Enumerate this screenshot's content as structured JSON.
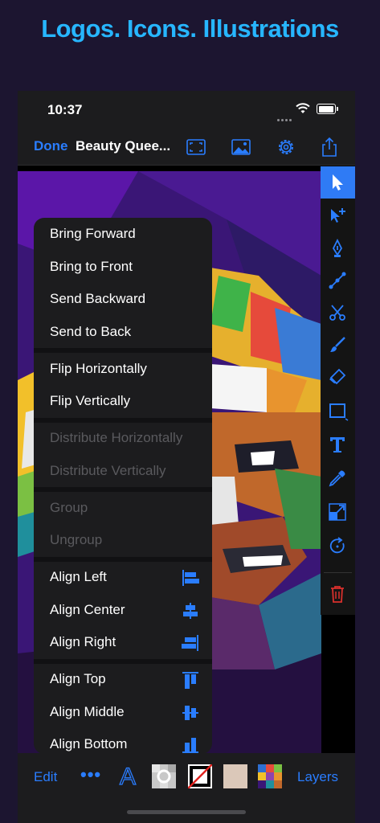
{
  "headline": "Logos. Icons. Illustrations",
  "status_bar": {
    "time": "10:37"
  },
  "nav_bar": {
    "done_label": "Done",
    "title": "Beauty Quee...",
    "icons": [
      "fit-screen-icon",
      "image-icon",
      "gear-icon",
      "share-icon"
    ]
  },
  "context_menu": {
    "groups": [
      [
        {
          "label": "Bring Forward",
          "enabled": true
        },
        {
          "label": "Bring to Front",
          "enabled": true
        },
        {
          "label": "Send Backward",
          "enabled": true
        },
        {
          "label": "Send to Back",
          "enabled": true
        }
      ],
      [
        {
          "label": "Flip Horizontally",
          "enabled": true
        },
        {
          "label": "Flip Vertically",
          "enabled": true
        }
      ],
      [
        {
          "label": "Distribute Horizontally",
          "enabled": false
        },
        {
          "label": "Distribute Vertically",
          "enabled": false
        }
      ],
      [
        {
          "label": "Group",
          "enabled": false
        },
        {
          "label": "Ungroup",
          "enabled": false
        }
      ],
      [
        {
          "label": "Align Left",
          "enabled": true,
          "icon": "align-left-icon"
        },
        {
          "label": "Align Center",
          "enabled": true,
          "icon": "align-center-icon"
        },
        {
          "label": "Align Right",
          "enabled": true,
          "icon": "align-right-icon"
        }
      ],
      [
        {
          "label": "Align Top",
          "enabled": true,
          "icon": "align-top-icon"
        },
        {
          "label": "Align Middle",
          "enabled": true,
          "icon": "align-middle-icon"
        },
        {
          "label": "Align Bottom",
          "enabled": true,
          "icon": "align-bottom-icon"
        }
      ]
    ]
  },
  "tools": [
    "select-arrow-icon",
    "node-select-icon",
    "pen-tool-icon",
    "bezier-icon",
    "scissors-icon",
    "brush-icon",
    "eraser-icon",
    "rectangle-icon",
    "text-tool-icon",
    "eyedropper-icon",
    "transform-icon",
    "rotate-icon",
    "trash-icon"
  ],
  "bottom_bar": {
    "edit_label": "Edit",
    "more_label": "•••",
    "layers_label": "Layers",
    "text_style_letter": "A",
    "swatch_color": "#dbc8b9"
  },
  "colors": {
    "accent": "#2a7dff",
    "headline": "#27b6ff",
    "destructive": "#d9302c"
  }
}
